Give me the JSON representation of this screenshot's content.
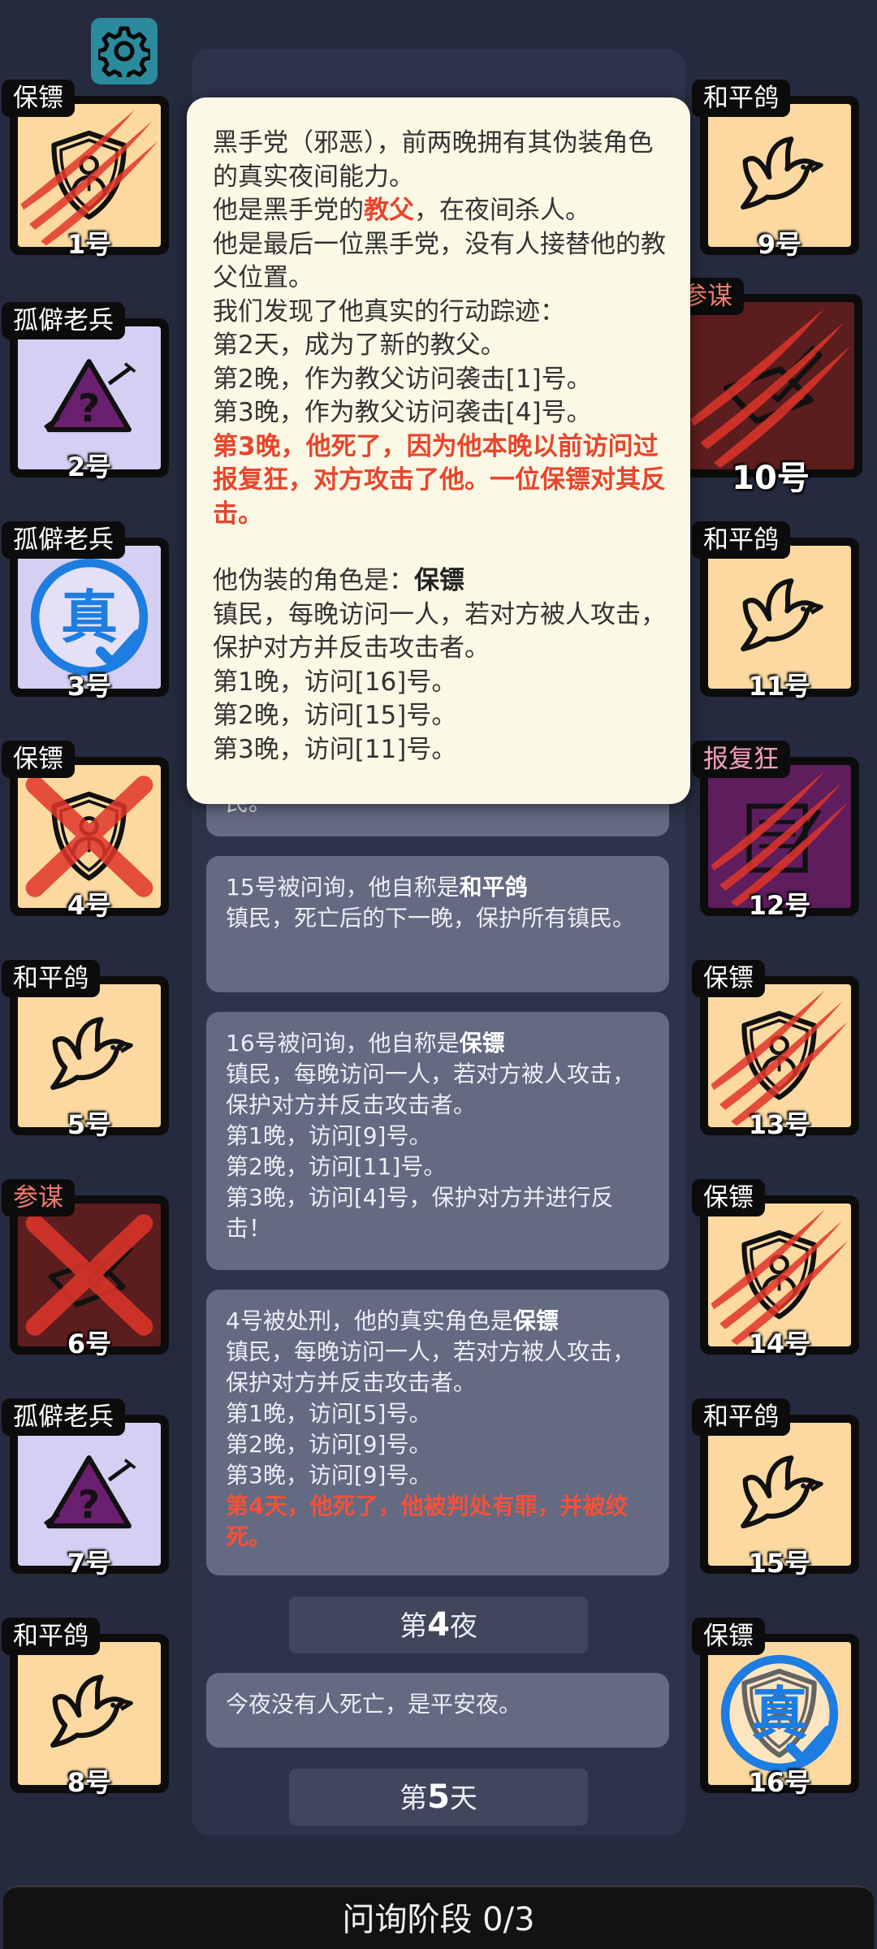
{
  "popup": {
    "l1": "黑手党（邪恶），前两晚拥有其伪装角色的真实夜间能力。",
    "l2a": "他是黑手党的",
    "l2b": "教父",
    "l2c": "，在夜间杀人。",
    "l3": "他是最后一位黑手党，没有人接替他的教父位置。",
    "l4": "我们发现了他真实的行动踪迹：",
    "l5": "第2天，成为了新的教父。",
    "l6": "第2晚，作为教父访问袭击[1]号。",
    "l7": "第3晚，作为教父访问袭击[4]号。",
    "l8": "第3晚，他死了，因为他本晚以前访问过报复狂，对方攻击了他。一位保镖对其反击。",
    "l9a": "他伪装的角色是：",
    "l9b": "保镖",
    "l10": "镇民，每晚访问一人，若对方被人攻击，保护对方并反击攻击者。",
    "l11": "第1晚，访问[16]号。",
    "l12": "第2晚，访问[15]号。",
    "l13": "第3晚，访问[11]号。"
  },
  "log": {
    "m0_tail": "民。",
    "m1_a": "15号被问询，他自称是",
    "m1_b": "和平鸽",
    "m1_c": "镇民，死亡后的下一晚，保护所有镇民。",
    "m2_a": "16号被问询，他自称是",
    "m2_b": "保镖",
    "m2_c": "镇民，每晚访问一人，若对方被人攻击，保护对方并反击攻击者。",
    "m2_d": "第1晚，访问[9]号。",
    "m2_e": "第2晚，访问[11]号。",
    "m2_f": "第3晚，访问[4]号，保护对方并进行反击！",
    "m3_a": "4号被处刑，他的真实角色是",
    "m3_b": "保镖",
    "m3_c": "镇民，每晚访问一人，若对方被人攻击，保护对方并反击攻击者。",
    "m3_d": "第1晚，访问[5]号。",
    "m3_e": "第2晚，访问[9]号。",
    "m3_f": "第3晚，访问[9]号。",
    "m3_g": "第4天，他死了，他被判处有罪，并被绞死。",
    "night4_a": "第",
    "night4_n": "4",
    "night4_b": "夜",
    "m4": "今夜没有人死亡，是平安夜。",
    "day5_a": "第",
    "day5_n": "5",
    "day5_b": "天"
  },
  "players": [
    {
      "num": "1号",
      "role": "保镖",
      "icon": "shield-person-icon",
      "state": "clawed"
    },
    {
      "num": "2号",
      "role": "孤僻老兵",
      "icon": "warning-question-icon",
      "state": "normal"
    },
    {
      "num": "3号",
      "role": "孤僻老兵",
      "icon": "verified-true-icon",
      "state": "verified",
      "verified_label": "真"
    },
    {
      "num": "4号",
      "role": "保镖",
      "icon": "shield-person-icon",
      "state": "crossed"
    },
    {
      "num": "5号",
      "role": "和平鸽",
      "icon": "dove-icon",
      "state": "normal"
    },
    {
      "num": "6号",
      "role": "参谋",
      "icon": "document-pen-icon",
      "state": "crossed"
    },
    {
      "num": "7号",
      "role": "孤僻老兵",
      "icon": "warning-question-icon",
      "state": "normal"
    },
    {
      "num": "8号",
      "role": "和平鸽",
      "icon": "dove-icon",
      "state": "normal"
    },
    {
      "num": "9号",
      "role": "和平鸽",
      "icon": "dove-icon",
      "state": "normal"
    },
    {
      "num": "10号",
      "role": "参谋",
      "icon": "document-pen-icon",
      "state": "clawed-selected"
    },
    {
      "num": "11号",
      "role": "和平鸽",
      "icon": "dove-icon",
      "state": "normal"
    },
    {
      "num": "12号",
      "role": "报复狂",
      "icon": "notebook-icon",
      "state": "clawed"
    },
    {
      "num": "13号",
      "role": "保镖",
      "icon": "shield-person-icon",
      "state": "clawed"
    },
    {
      "num": "14号",
      "role": "保镖",
      "icon": "shield-person-icon",
      "state": "clawed"
    },
    {
      "num": "15号",
      "role": "和平鸽",
      "icon": "dove-icon",
      "state": "normal"
    },
    {
      "num": "16号",
      "role": "保镖",
      "icon": "shield-person-icon",
      "state": "verified",
      "verified_label": "真"
    }
  ],
  "bottom": {
    "label": "问询阶段 0/3"
  },
  "colors": {
    "background": "#252a3e",
    "card_tan": "#fbd9a1",
    "card_lavender": "#d5d0f3",
    "accent_red": "#e8452c",
    "verified_blue": "#1e7de0"
  }
}
